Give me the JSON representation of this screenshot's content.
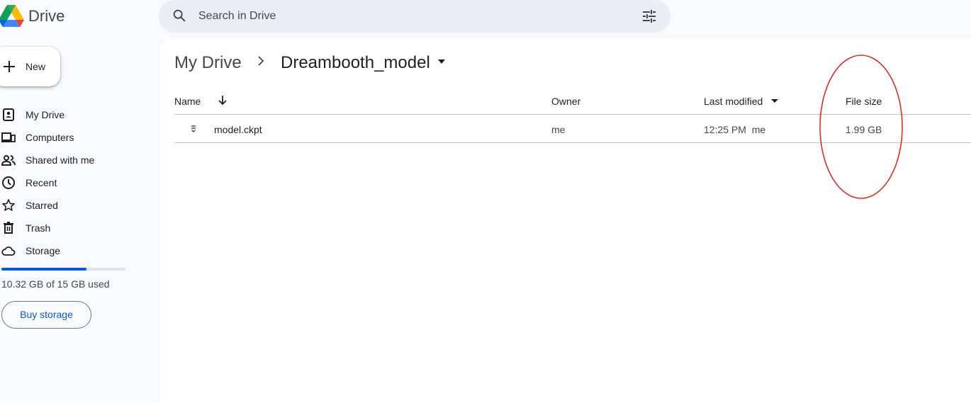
{
  "app": {
    "brand": "Drive"
  },
  "search": {
    "placeholder": "Search in Drive"
  },
  "sidebar": {
    "new_label": "New",
    "items": [
      {
        "label": "My Drive",
        "icon": "my-drive-icon"
      },
      {
        "label": "Computers",
        "icon": "computers-icon"
      },
      {
        "label": "Shared with me",
        "icon": "shared-icon"
      },
      {
        "label": "Recent",
        "icon": "clock-icon"
      },
      {
        "label": "Starred",
        "icon": "star-icon"
      },
      {
        "label": "Trash",
        "icon": "trash-icon"
      },
      {
        "label": "Storage",
        "icon": "cloud-icon"
      }
    ],
    "storage": {
      "text": "10.32 GB of 15 GB used",
      "used_fraction": 0.688
    },
    "buy_label": "Buy storage"
  },
  "breadcrumb": {
    "root": "My Drive",
    "current": "Dreambooth_model"
  },
  "table": {
    "headers": {
      "name": "Name",
      "owner": "Owner",
      "modified": "Last modified",
      "size": "File size"
    },
    "rows": [
      {
        "name": "model.ckpt",
        "owner": "me",
        "modified": "12:25 PM  me",
        "size": "1.99 GB"
      }
    ]
  },
  "colors": {
    "accent": "#0b57d0",
    "annotation": "#d93025",
    "background": "#f8fafd"
  }
}
